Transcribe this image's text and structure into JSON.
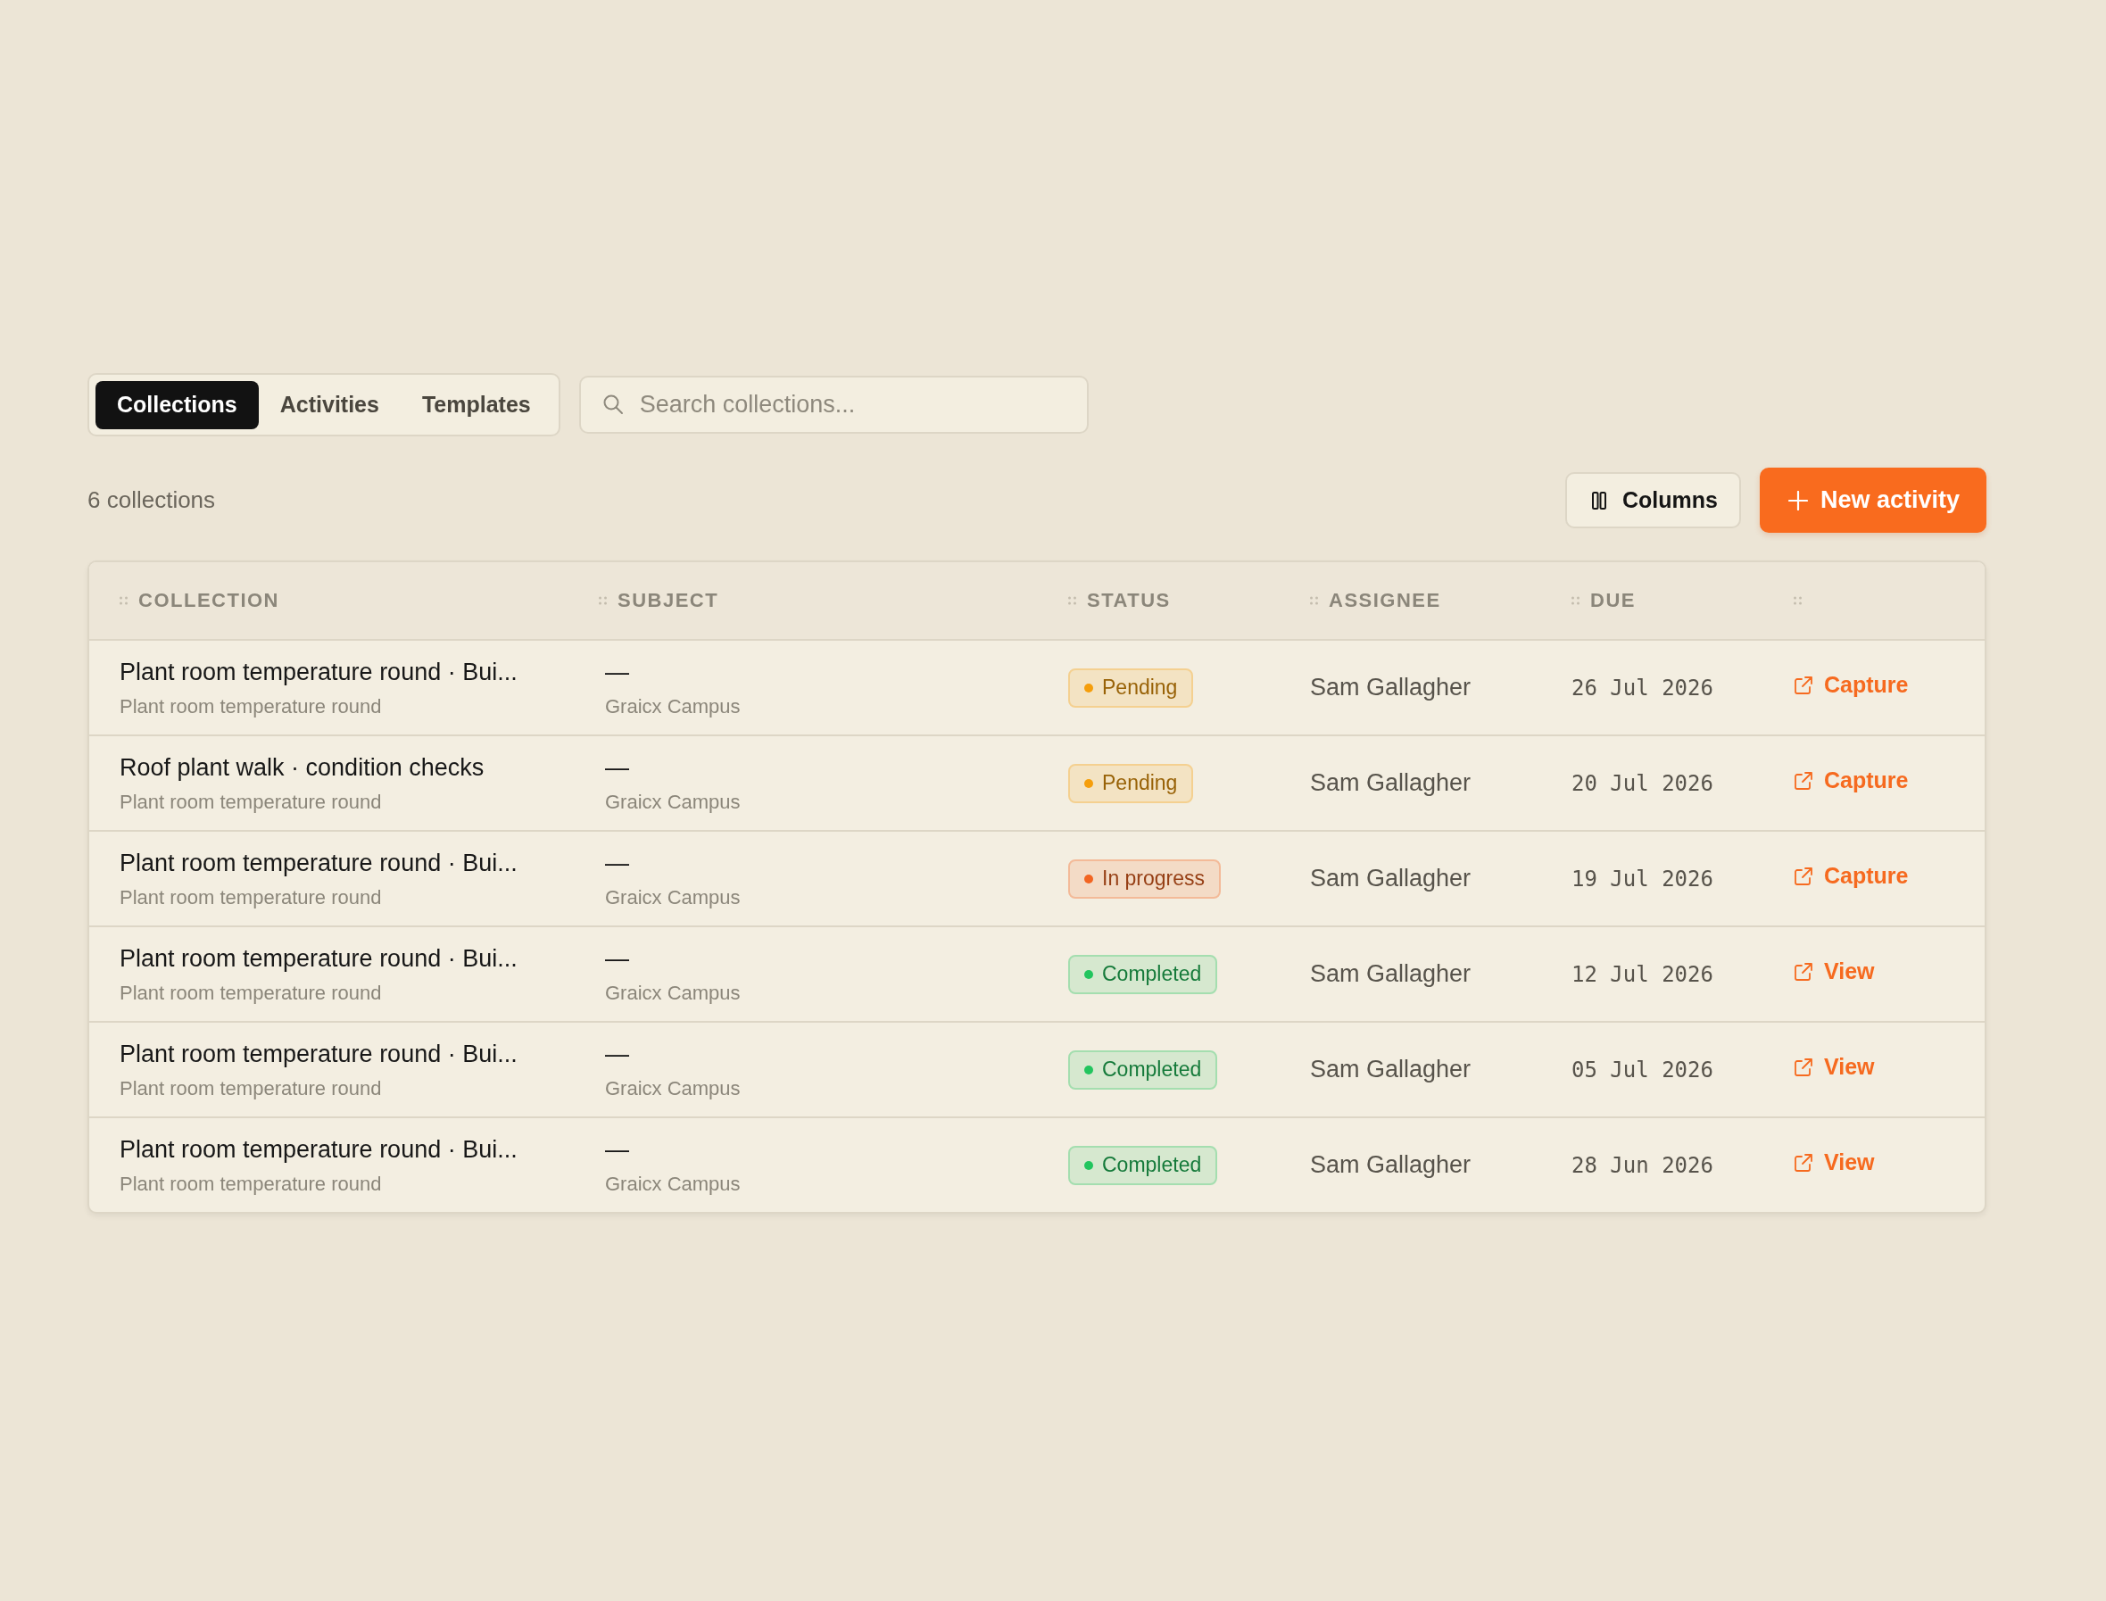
{
  "tabs": [
    {
      "label": "Collections",
      "selected": true
    },
    {
      "label": "Activities",
      "selected": false
    },
    {
      "label": "Templates",
      "selected": false
    }
  ],
  "search": {
    "placeholder": "Search collections..."
  },
  "count": "6 collections",
  "buttons": [
    {
      "label": "Columns",
      "kind": "secondary"
    },
    {
      "label": "New activity",
      "kind": "primary"
    }
  ],
  "table": {
    "columns": [
      "COLLECTION",
      "SUBJECT",
      "STATUS",
      "ASSIGNEE",
      "DUE"
    ],
    "rows": [
      {
        "title": "Plant room temperature round · Bui...",
        "subtitle": "Plant room temperature round",
        "subject": "—",
        "location": "Graicx Campus",
        "status": {
          "label": "Pending",
          "color": "#f59e0b"
        },
        "assignee": "Sam Gallagher",
        "due": "26 Jul 2026",
        "action": "Capture"
      },
      {
        "title": "Roof plant walk · condition checks",
        "subtitle": "Plant room temperature round",
        "subject": "—",
        "location": "Graicx Campus",
        "status": {
          "label": "Pending",
          "color": "#f59e0b"
        },
        "assignee": "Sam Gallagher",
        "due": "20 Jul 2026",
        "action": "Capture"
      },
      {
        "title": "Plant room temperature round · Bui...",
        "subtitle": "Plant room temperature round",
        "subject": "—",
        "location": "Graicx Campus",
        "status": {
          "label": "In progress",
          "color": "#f26522"
        },
        "assignee": "Sam Gallagher",
        "due": "19 Jul 2026",
        "action": "Capture"
      },
      {
        "title": "Plant room temperature round · Bui...",
        "subtitle": "Plant room temperature round",
        "subject": "—",
        "location": "Graicx Campus",
        "status": {
          "label": "Completed",
          "color": "#22c55e"
        },
        "assignee": "Sam Gallagher",
        "due": "12 Jul 2026",
        "action": "View"
      },
      {
        "title": "Plant room temperature round · Bui...",
        "subtitle": "Plant room temperature round",
        "subject": "—",
        "location": "Graicx Campus",
        "status": {
          "label": "Completed",
          "color": "#22c55e"
        },
        "assignee": "Sam Gallagher",
        "due": "05 Jul 2026",
        "action": "View"
      },
      {
        "title": "Plant room temperature round · Bui...",
        "subtitle": "Plant room temperature round",
        "subject": "—",
        "location": "Graicx Campus",
        "status": {
          "label": "Completed",
          "color": "#22c55e"
        },
        "assignee": "Sam Gallagher",
        "due": "28 Jun 2026",
        "action": "View"
      }
    ]
  }
}
